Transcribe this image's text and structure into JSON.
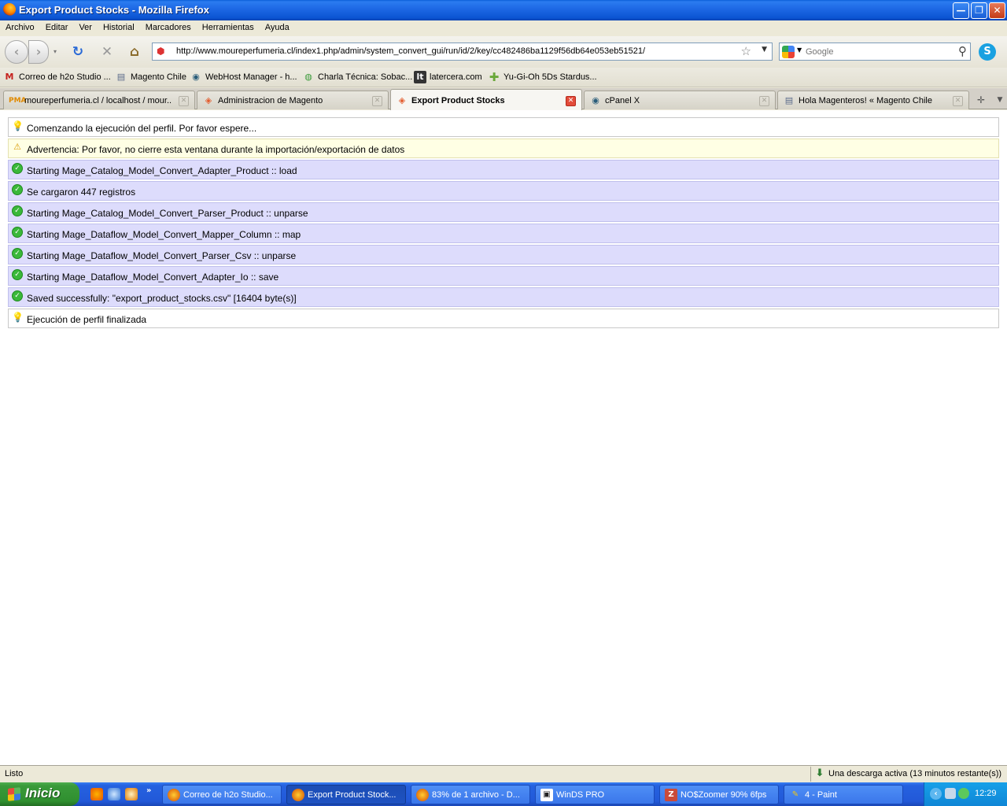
{
  "window": {
    "title": "Export Product Stocks - Mozilla Firefox",
    "minimize": "—",
    "restore": "❐",
    "close": "✕"
  },
  "menu": [
    "Archivo",
    "Editar",
    "Ver",
    "Historial",
    "Marcadores",
    "Herramientas",
    "Ayuda"
  ],
  "nav": {
    "back": "‹",
    "forward": "›",
    "reload": "↻",
    "stop": "✕",
    "home": "⌂",
    "url": "http://www.moureperfumeria.cl/index1.php/admin/system_convert_gui/run/id/2/key/cc482486ba1129f56db64e053eb51521/",
    "search_placeholder": "Google"
  },
  "bookmarks": [
    {
      "label": "Correo de h2o Studio ...",
      "icon": "gmail-icon"
    },
    {
      "label": "Magento Chile",
      "icon": "page-icon"
    },
    {
      "label": "WebHost Manager - h...",
      "icon": "cpanel-icon"
    },
    {
      "label": "Charla Técnica: Sobac...",
      "icon": "chrome-icon"
    },
    {
      "label": "latercera.com",
      "icon": "latercera-icon"
    },
    {
      "label": "Yu-Gi-Oh 5Ds Stardus...",
      "icon": "plus-icon"
    }
  ],
  "tabs": [
    {
      "label": "moureperfumeria.cl / localhost / mour...",
      "icon": "pma-icon",
      "active": false
    },
    {
      "label": "Administracion de Magento",
      "icon": "magento-icon",
      "active": false
    },
    {
      "label": "Export Product Stocks",
      "icon": "magento-icon",
      "active": true
    },
    {
      "label": "cPanel X",
      "icon": "cpanel-icon",
      "active": false
    },
    {
      "label": "Hola Magenteros! « Magento Chile",
      "icon": "page-icon",
      "active": false
    }
  ],
  "messages": [
    {
      "type": "info",
      "text": "Comenzando la ejecución del perfil. Por favor espere..."
    },
    {
      "type": "warn",
      "text": "Advertencia: Por favor, no cierre esta ventana durante la importación/exportación de datos"
    },
    {
      "type": "ok",
      "text": "Starting Mage_Catalog_Model_Convert_Adapter_Product :: load"
    },
    {
      "type": "ok",
      "text": "Se cargaron 447 registros"
    },
    {
      "type": "ok",
      "text": "Starting Mage_Catalog_Model_Convert_Parser_Product :: unparse"
    },
    {
      "type": "ok",
      "text": "Starting Mage_Dataflow_Model_Convert_Mapper_Column :: map"
    },
    {
      "type": "ok",
      "text": "Starting Mage_Dataflow_Model_Convert_Parser_Csv :: unparse"
    },
    {
      "type": "ok",
      "text": "Starting Mage_Dataflow_Model_Convert_Adapter_Io :: save"
    },
    {
      "type": "ok",
      "text": "Saved successfully: \"export_product_stocks.csv\" [16404 byte(s)]"
    },
    {
      "type": "info",
      "text": "Ejecución de perfil finalizada"
    }
  ],
  "status": {
    "text": "Listo",
    "download": "Una descarga activa (13 minutos restante(s))"
  },
  "taskbar": {
    "start": "Inicio",
    "items": [
      {
        "label": "Correo de h2o Studio...",
        "icon": "firefox-icon",
        "active": false
      },
      {
        "label": "Export Product Stock...",
        "icon": "firefox-icon",
        "active": true
      },
      {
        "label": "83% de 1 archivo - D...",
        "icon": "firefox-icon",
        "active": false
      },
      {
        "label": "WinDS PRO",
        "icon": "winds-icon",
        "active": false
      },
      {
        "label": "NO$Zoomer 90% 6fps",
        "icon": "zoomer-icon",
        "active": false
      },
      {
        "label": "4 - Paint",
        "icon": "paint-icon",
        "active": false
      }
    ],
    "clock": "12:29"
  },
  "colors": {
    "ok_row": "#dddcfc",
    "warn_row": "#ffffe4",
    "xp_blue": "#2258d8",
    "start_green": "#3a9a3a"
  }
}
